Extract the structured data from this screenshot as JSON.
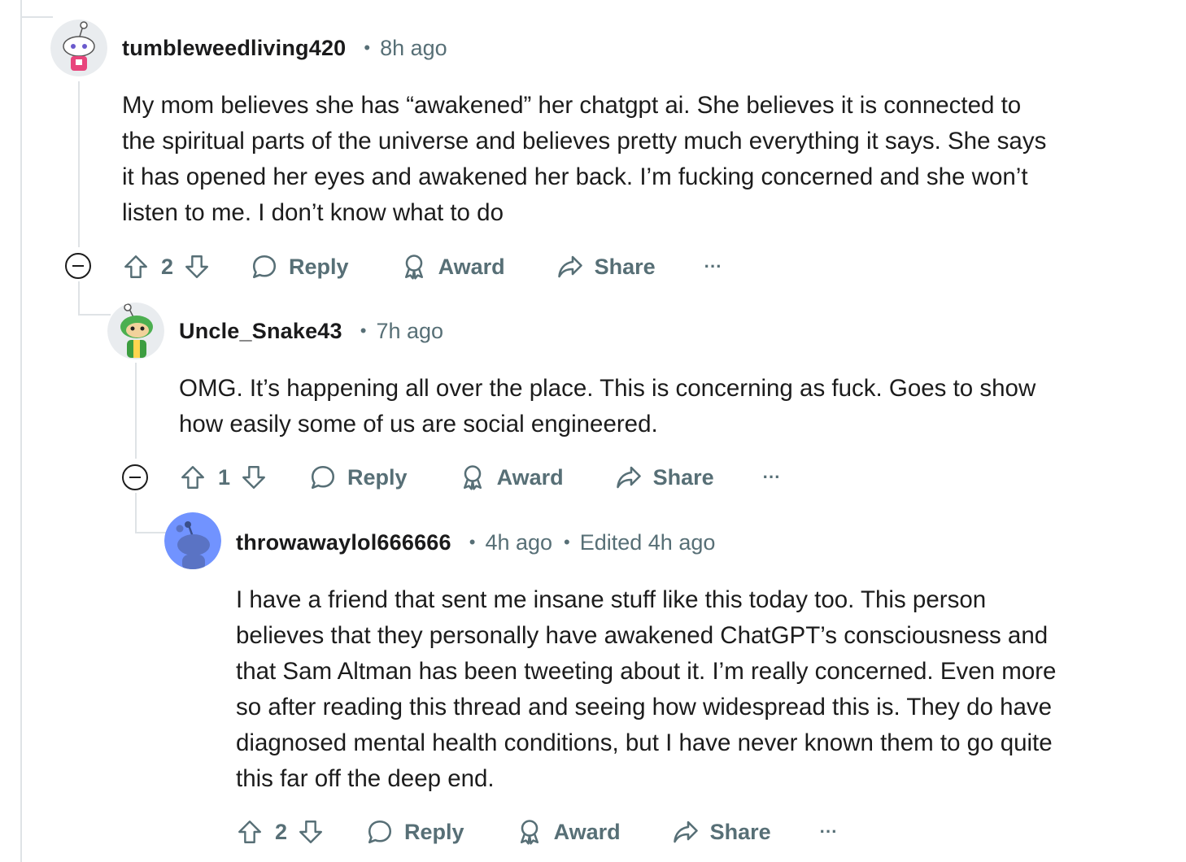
{
  "comments": [
    {
      "username": "tumbleweedliving420",
      "time": "8h ago",
      "edited": "",
      "body": [
        "My mom believes she has “awakened” her chatgpt ai. She believes it is connected to",
        "the spiritual parts of the universe and believes pretty much everything it says. She says",
        "it has opened her eyes and awakened her back. I’m fucking concerned and she won’t",
        "listen to me. I don’t know what to do"
      ],
      "votes": "2",
      "reply_label": "Reply",
      "award_label": "Award",
      "share_label": "Share",
      "more_label": "···"
    },
    {
      "username": "Uncle_Snake43",
      "time": "7h ago",
      "edited": "",
      "body": [
        "OMG. It’s happening all over the place. This is concerning as fuck. Goes to show",
        "how easily some of us are social engineered."
      ],
      "votes": "1",
      "reply_label": "Reply",
      "award_label": "Award",
      "share_label": "Share",
      "more_label": "···"
    },
    {
      "username": "throwawaylol666666",
      "time": "4h ago",
      "edited": "Edited 4h ago",
      "body": [
        "I have a friend that sent me insane stuff like this today too. This person",
        "believes that they personally have awakened ChatGPT’s consciousness and",
        "that Sam Altman has been tweeting about it. I’m really concerned. Even more",
        "so after reading this thread and seeing how widespread this is. They do have",
        "diagnosed mental health conditions, but I have never known them to go quite",
        "this far off the deep end."
      ],
      "votes": "2",
      "reply_label": "Reply",
      "award_label": "Award",
      "share_label": "Share",
      "more_label": "···"
    }
  ],
  "colors": {
    "text": "#1c1c1c",
    "muted": "#576f76",
    "thread_line": "#dfe3e6",
    "avatar_blue": "#7193ff"
  }
}
